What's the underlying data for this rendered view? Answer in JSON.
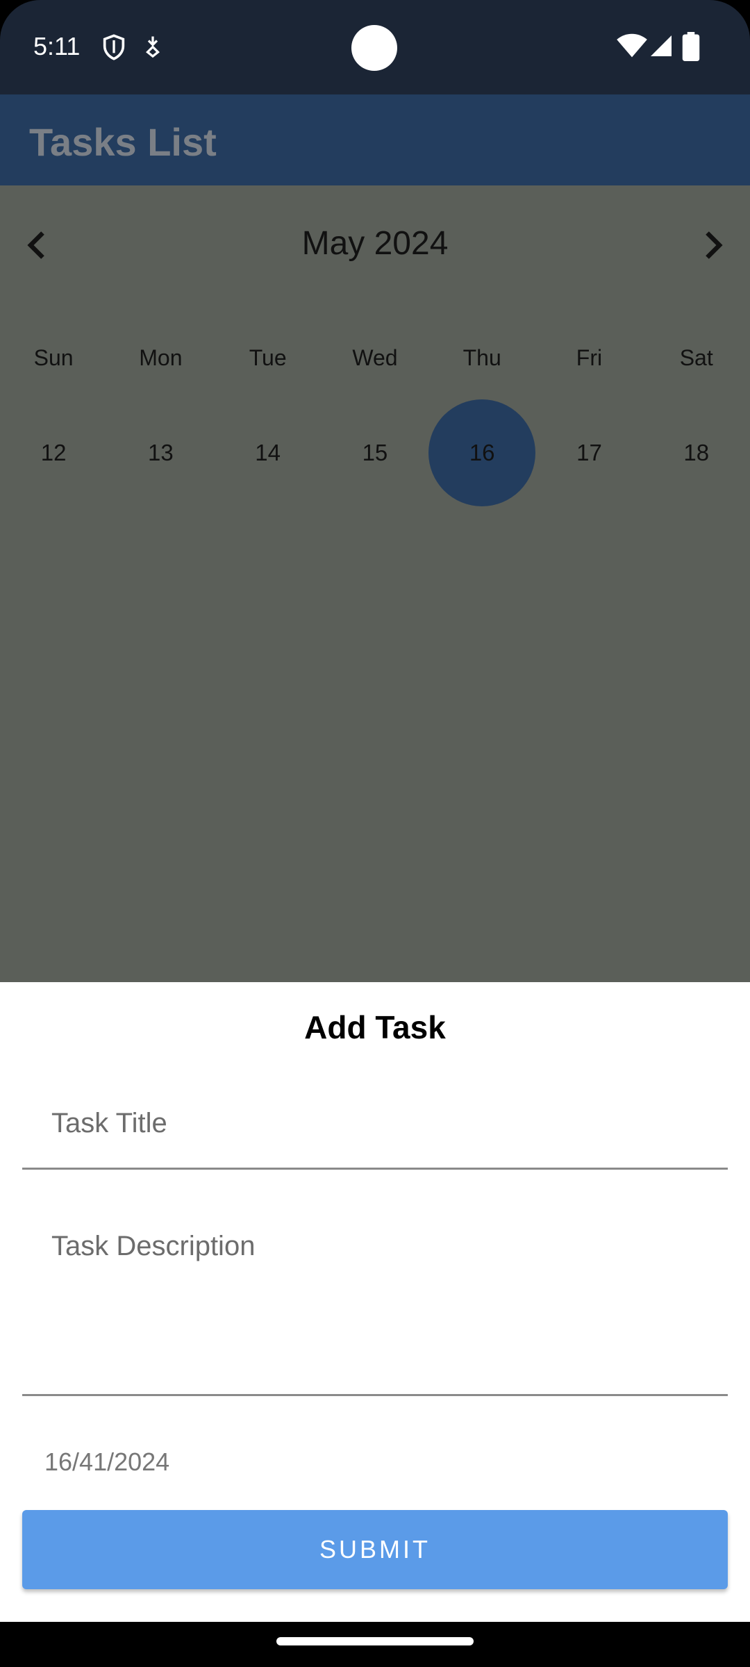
{
  "status_bar": {
    "time": "5:11",
    "icons": [
      "shield-icon",
      "download-icon",
      "wifi-icon",
      "signal-icon",
      "battery-icon"
    ]
  },
  "app_bar": {
    "title": "Tasks List",
    "background": "#233d5e"
  },
  "calendar": {
    "month_label": "May 2024",
    "prev_icon": "chevron-left-icon",
    "next_icon": "chevron-right-icon",
    "weekdays": [
      "Sun",
      "Mon",
      "Tue",
      "Wed",
      "Thu",
      "Fri",
      "Sat"
    ],
    "days": [
      "12",
      "13",
      "14",
      "15",
      "16",
      "17",
      "18"
    ],
    "selected_day": "16"
  },
  "add_task": {
    "title": "Add Task",
    "task_title_placeholder": "Task Title",
    "task_description_placeholder": "Task Description",
    "date_text": "16/41/2024",
    "submit_label": "SUBMIT",
    "accent": "#5b9be8"
  }
}
